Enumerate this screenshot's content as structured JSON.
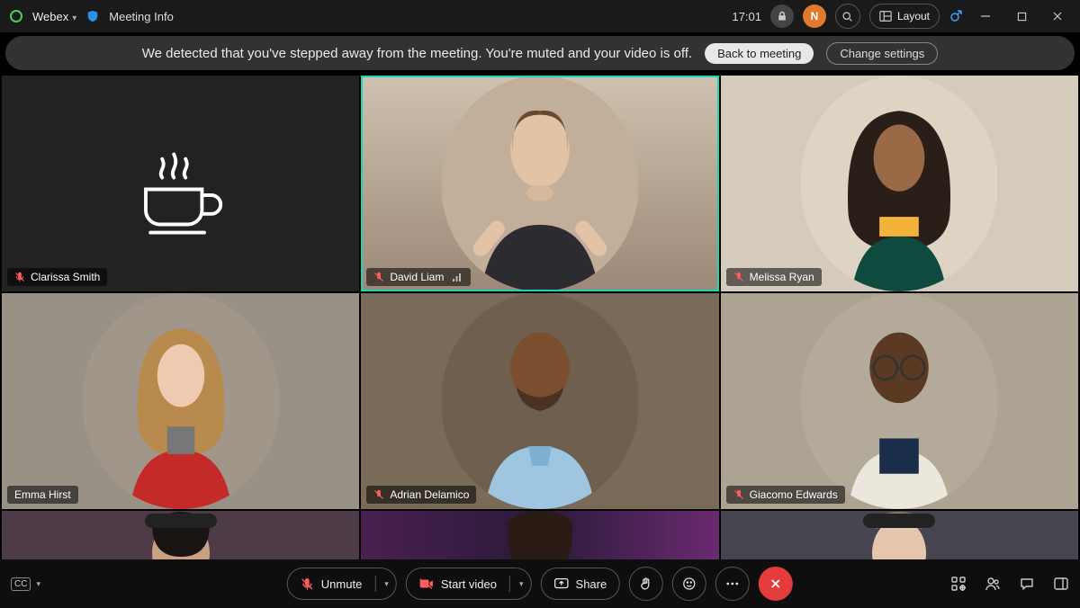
{
  "titlebar": {
    "app": "Webex",
    "meeting_info": "Meeting Info",
    "clock": "17:01",
    "layout": "Layout"
  },
  "banner": {
    "message": "We detected that you've stepped away from the meeting. You're muted and your video is off.",
    "back_btn": "Back to meeting",
    "settings_btn": "Change settings"
  },
  "participants": [
    {
      "name": "Clarissa Smith",
      "muted": true,
      "speaking": false,
      "away": true,
      "bg": "#2a2a2a"
    },
    {
      "name": "David Liam",
      "muted": true,
      "speaking": true,
      "away": false,
      "bg": "#b09a87",
      "signal": true
    },
    {
      "name": "Melissa Ryan",
      "muted": true,
      "speaking": false,
      "away": false,
      "bg": "#c7b9a6"
    },
    {
      "name": "Emma Hirst",
      "muted": false,
      "speaking": false,
      "away": false,
      "bg": "#8a8378"
    },
    {
      "name": "Adrian Delamico",
      "muted": true,
      "speaking": false,
      "away": false,
      "bg": "#6b5a4a"
    },
    {
      "name": "Giacomo Edwards",
      "muted": true,
      "speaking": false,
      "away": false,
      "bg": "#9a9285"
    },
    {
      "name": "",
      "muted": false,
      "speaking": false,
      "away": false,
      "bg": "#4a3a48"
    },
    {
      "name": "",
      "muted": false,
      "speaking": false,
      "away": false,
      "bg": "#3a2a48"
    },
    {
      "name": "",
      "muted": false,
      "speaking": false,
      "away": false,
      "bg": "#3d3a44"
    }
  ],
  "footer": {
    "cc": "CC",
    "unmute": "Unmute",
    "start_video": "Start video",
    "share": "Share"
  }
}
